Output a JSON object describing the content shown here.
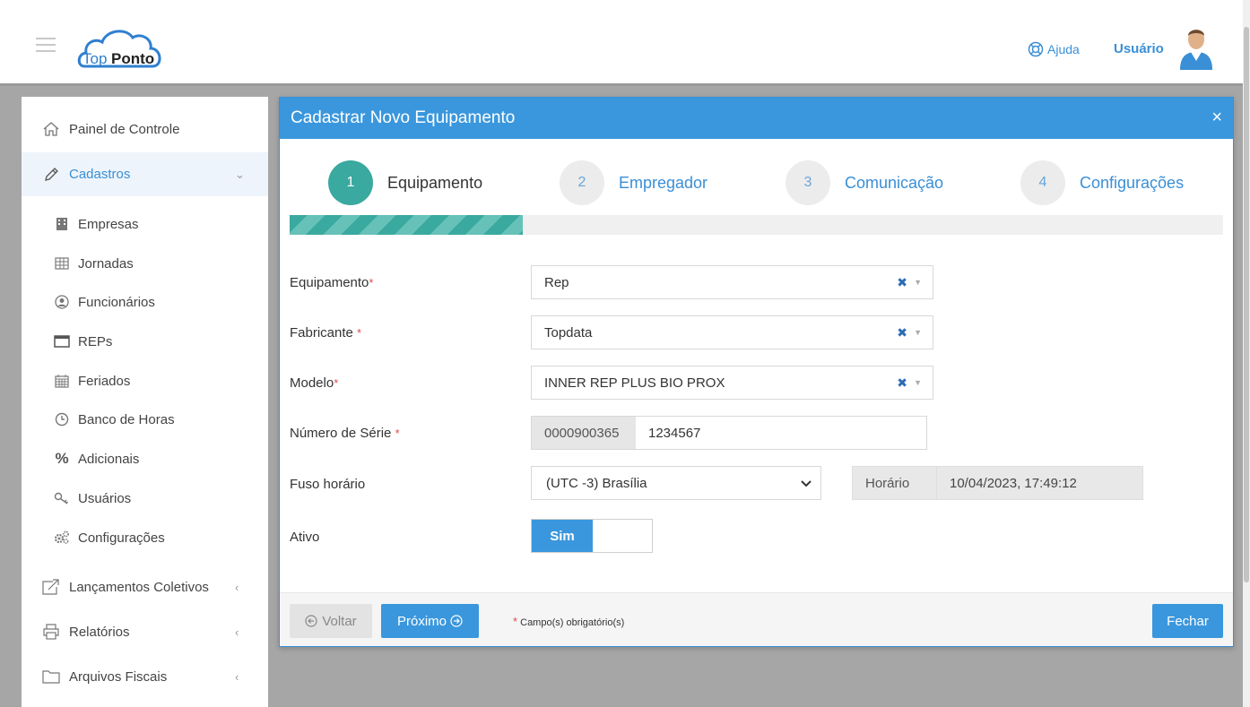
{
  "header": {
    "logo_text_a": "Top",
    "logo_text_b": "Ponto",
    "help_label": "Ajuda",
    "user_name": "Usuário"
  },
  "sidebar": {
    "items": [
      {
        "label": "Painel de Controle",
        "icon": "home-icon"
      },
      {
        "label": "Cadastros",
        "icon": "pencil-icon",
        "expanded": true
      },
      {
        "label": "Lançamentos Coletivos",
        "icon": "share-icon"
      },
      {
        "label": "Relatórios",
        "icon": "printer-icon"
      },
      {
        "label": "Arquivos Fiscais",
        "icon": "folder-icon"
      }
    ],
    "sub_items": [
      {
        "label": "Empresas",
        "icon": "building-icon"
      },
      {
        "label": "Jornadas",
        "icon": "table-icon"
      },
      {
        "label": "Funcionários",
        "icon": "user-circle-icon"
      },
      {
        "label": "REPs",
        "icon": "window-icon"
      },
      {
        "label": "Feriados",
        "icon": "calendar-icon"
      },
      {
        "label": "Banco de Horas",
        "icon": "clock-icon"
      },
      {
        "label": "Adicionais",
        "icon": "percent-icon"
      },
      {
        "label": "Usuários",
        "icon": "key-icon"
      },
      {
        "label": "Configurações",
        "icon": "gears-icon"
      }
    ]
  },
  "modal": {
    "title": "Cadastrar Novo Equipamento",
    "close": "×",
    "steps": [
      {
        "num": "1",
        "label": "Equipamento",
        "active": true
      },
      {
        "num": "2",
        "label": "Empregador"
      },
      {
        "num": "3",
        "label": "Comunicação"
      },
      {
        "num": "4",
        "label": "Configurações"
      }
    ],
    "progress": 0.25,
    "fields": {
      "equipamento": {
        "label": "Equipamento",
        "required": "*",
        "value": "Rep"
      },
      "fabricante": {
        "label": "Fabricante",
        "required": "*",
        "value": "Topdata"
      },
      "modelo": {
        "label": "Modelo",
        "required": "*",
        "value": "INNER REP PLUS BIO PROX"
      },
      "serie": {
        "label": "Número de Série",
        "required": "*",
        "prefix": "0000900365",
        "value": "1234567"
      },
      "fuso": {
        "label": "Fuso horário",
        "value": "(UTC -3) Brasília"
      },
      "horario": {
        "label": "Horário",
        "value": "10/04/2023, 17:49:12"
      },
      "ativo": {
        "label": "Ativo",
        "value": "Sim"
      }
    },
    "footer": {
      "voltar": "Voltar",
      "proximo": "Próximo",
      "required_mark": "*",
      "required_note": "Campo(s) obrigatório(s)",
      "fechar": "Fechar"
    }
  },
  "colors": {
    "primary": "#3a97dd",
    "step_active": "#3aa99f",
    "required": "#e04b4b"
  }
}
